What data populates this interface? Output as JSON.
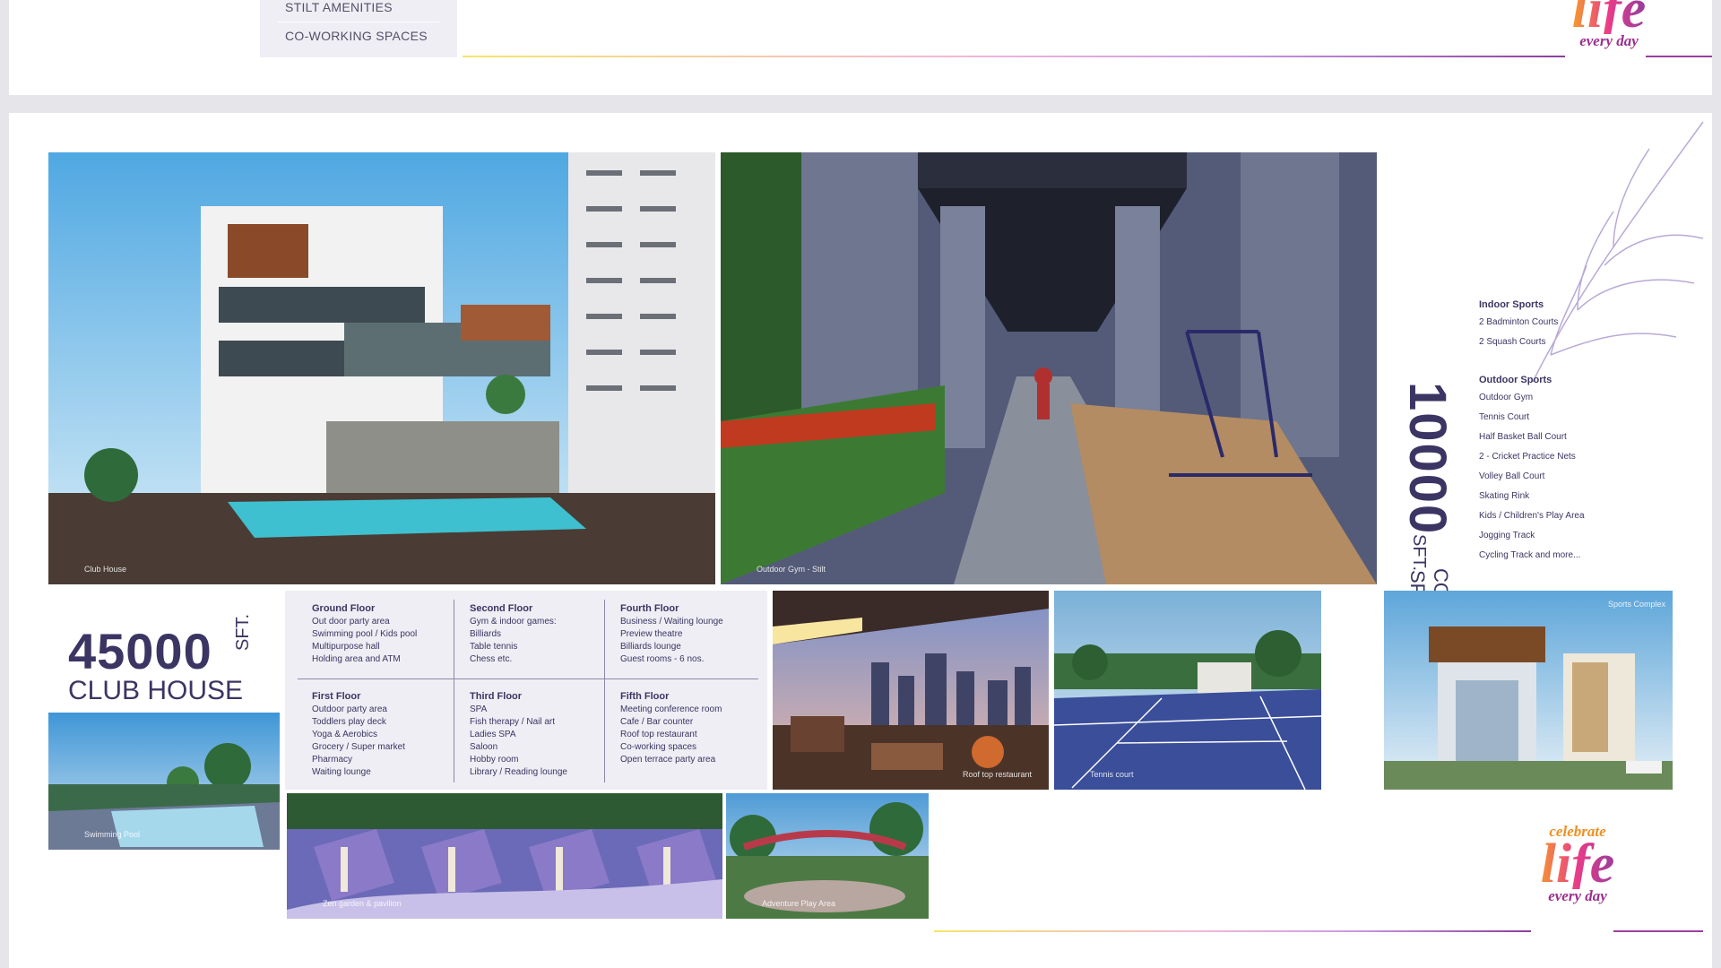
{
  "top_panel": {
    "amenities": [
      "STILT AMENITIES",
      "CO-WORKING SPACES"
    ]
  },
  "logo": {
    "line1": "celebrate",
    "line2": "life",
    "line3": "every day"
  },
  "photos": {
    "club_house": "Club House",
    "outdoor_gym": "Outdoor Gym - Stilt",
    "roof_top": "Roof top restaurant",
    "tennis": "Tennis court",
    "sports_complex": "Sports Complex",
    "swimming_pool": "Swimming Pool",
    "zen_garden": "Zen garden & pavilion",
    "adventure": "Adventure Play Area"
  },
  "club_house": {
    "area": "45000",
    "unit": "SFT.",
    "label": "CLUB HOUSE"
  },
  "floors": [
    {
      "title": "Ground Floor",
      "items": [
        "Out door party area",
        "Swimming pool / Kids pool",
        "Multipurpose hall",
        "Holding area and ATM"
      ]
    },
    {
      "title": "Second Floor",
      "items": [
        "Gym & indoor games:",
        "Billiards",
        "Table tennis",
        "Chess etc."
      ]
    },
    {
      "title": "Fourth Floor",
      "items": [
        "Business / Waiting lounge",
        "Preview theatre",
        "Billiards lounge",
        "Guest rooms - 6 nos."
      ]
    },
    {
      "title": "First Floor",
      "items": [
        "Outdoor party area",
        "Toddlers play deck",
        "Yoga & Aerobics",
        "Grocery / Super market",
        "Pharmacy",
        "Waiting lounge"
      ]
    },
    {
      "title": "Third Floor",
      "items": [
        "SPA",
        "Fish therapy / Nail art",
        "Ladies SPA",
        "Saloon",
        "Hobby room",
        "Library / Reading lounge"
      ]
    },
    {
      "title": "Fifth Floor",
      "items": [
        "Meeting conference room",
        "Cafe / Bar counter",
        "Roof top restaurant",
        "Co-working spaces",
        "Open terrace party area"
      ]
    }
  ],
  "sports_complex": {
    "area": "10000",
    "unit": "SFT.",
    "label_line1": "SPORTS",
    "label_line2": "COMPLEX",
    "indoor_heading": "Indoor Sports",
    "indoor_items": [
      "2 Badminton Courts",
      "2 Squash Courts"
    ],
    "outdoor_heading": "Outdoor Sports",
    "outdoor_items": [
      "Outdoor Gym",
      "Tennis Court",
      "Half Basket Ball Court",
      "2 - Cricket Practice Nets",
      "Volley Ball Court",
      "Skating Rink",
      "Kids / Children's Play Area",
      "Jogging Track",
      "Cycling Track and more..."
    ]
  },
  "colors": {
    "brand_text": "#3b3563",
    "panel_bg": "#eeeef4"
  }
}
